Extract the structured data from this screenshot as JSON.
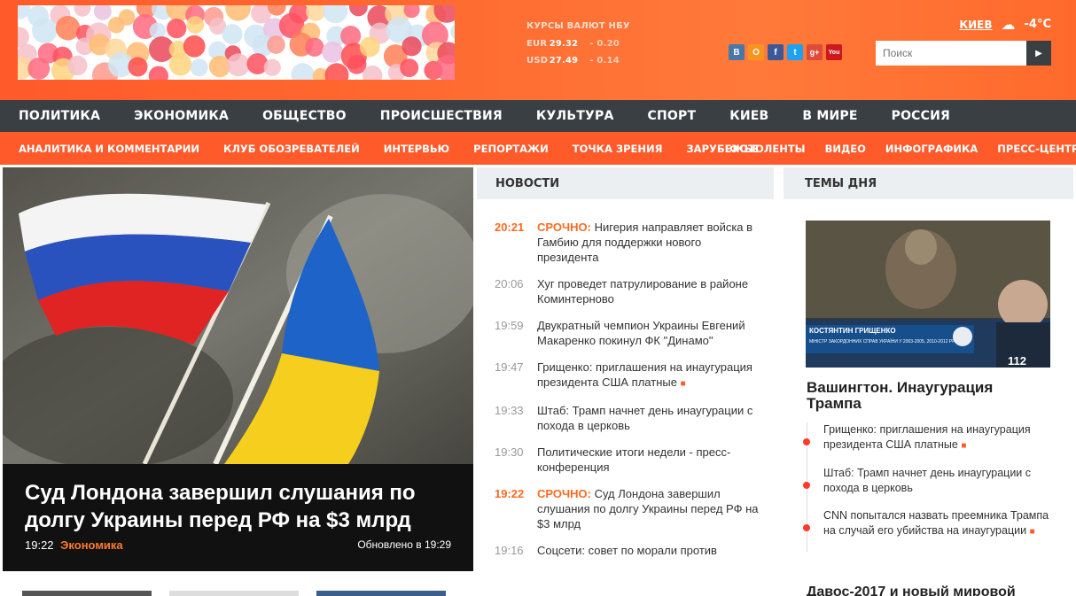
{
  "header": {
    "rates": {
      "title": "КУРСЫ ВАЛЮТ НБУ",
      "rows": [
        {
          "cur": "EUR",
          "value": "29.32",
          "change": "- 0.20"
        },
        {
          "cur": "USD",
          "value": "27.49",
          "change": "- 0.14"
        }
      ]
    },
    "social": [
      {
        "icon": "vkontakte-icon",
        "label": "В",
        "color": "#4a76a8"
      },
      {
        "icon": "odnoklassniki-icon",
        "label": "О",
        "color": "#f7931e"
      },
      {
        "icon": "facebook-icon",
        "label": "f",
        "color": "#3b5998"
      },
      {
        "icon": "twitter-icon",
        "label": "t",
        "color": "#1da1f2"
      },
      {
        "icon": "google-plus-icon",
        "label": "g+",
        "color": "#dd4b39"
      },
      {
        "icon": "youtube-icon",
        "label": "You",
        "color": "#cc181e"
      }
    ],
    "weather": {
      "city": "КИЕВ",
      "temp": "-4°C"
    },
    "search": {
      "placeholder": "Поиск"
    }
  },
  "nav_main": [
    "ПОЛИТИКА",
    "ЭКОНОМИКА",
    "ОБЩЕСТВО",
    "ПРОИСШЕСТВИЯ",
    "КУЛЬТУРА",
    "СПОРТ",
    "КИЕВ",
    "В МИРЕ",
    "РОССИЯ"
  ],
  "nav_sub_left": [
    "АНАЛИТИКА И КОММЕНТАРИИ",
    "КЛУБ ОБОЗРЕВАТЕЛЕЙ",
    "ИНТЕРВЬЮ",
    "РЕПОРТАЖИ",
    "ТОЧКА ЗРЕНИЯ",
    "ЗАРУБЕЖЬЕ"
  ],
  "nav_sub_right": [
    "ФОТОЛЕНТЫ",
    "ВИДЕО",
    "ИНФОГРАФИКА",
    "ПРЕСС-ЦЕНТР"
  ],
  "feature": {
    "headline": "Суд Лондона завершил слушания по долгу Украины перед РФ на $3 млрд",
    "time": "19:22",
    "category": "Экономика",
    "updated": "Обновлено в 19:29"
  },
  "news": {
    "title": "НОВОСТИ",
    "items": [
      {
        "time": "20:21",
        "urgent": "СРОЧНО:",
        "text": "Нигерия направляет войска в Гамбию для поддержки нового президента"
      },
      {
        "time": "20:06",
        "urgent": "",
        "text": "Хуг проведет патрулирование в районе Коминтерново"
      },
      {
        "time": "19:59",
        "urgent": "",
        "text": "Двукратный чемпион Украины Евгений Макаренко покинул ФК \"Динамо\""
      },
      {
        "time": "19:47",
        "urgent": "",
        "text": "Грищенко: приглашения на инаугурация президента США платные",
        "video": "■"
      },
      {
        "time": "19:33",
        "urgent": "",
        "text": "Штаб: Трамп начнет день инаугурации с похода в церковь"
      },
      {
        "time": "19:30",
        "urgent": "",
        "text": "Политические итоги недели - пресс-конференция"
      },
      {
        "time": "19:22",
        "urgent": "СРОЧНО:",
        "text": "Суд Лондона завершил слушания по долгу Украины перед РФ на $3 млрд"
      },
      {
        "time": "19:16",
        "urgent": "",
        "text": "Соцсети: совет по морали против"
      }
    ]
  },
  "themes": {
    "title": "ТЕМЫ ДНЯ",
    "image": {
      "banner_name": "КОСТЯНТИН ГРИЩЕНКО",
      "banner_sub": "МІНІСТР ЗАКОРДОННИХ СПРАВ УКРАЇНИ У 2003-2005, 2010-2012 РР.",
      "channel": "112"
    },
    "headline": "Вашингтон. Инаугурация Трампа",
    "items": [
      {
        "text": "Грищенко: приглашения на инаугурация президента США платные",
        "video": "■"
      },
      {
        "text": "Штаб: Трамп начнет день инаугурации с похода в церковь",
        "video": ""
      },
      {
        "text": "CNN попытался назвать преемника Трампа на случай его убийства на инаугурации",
        "video": "■"
      }
    ],
    "more": "Давос-2017 и новый мировой"
  }
}
